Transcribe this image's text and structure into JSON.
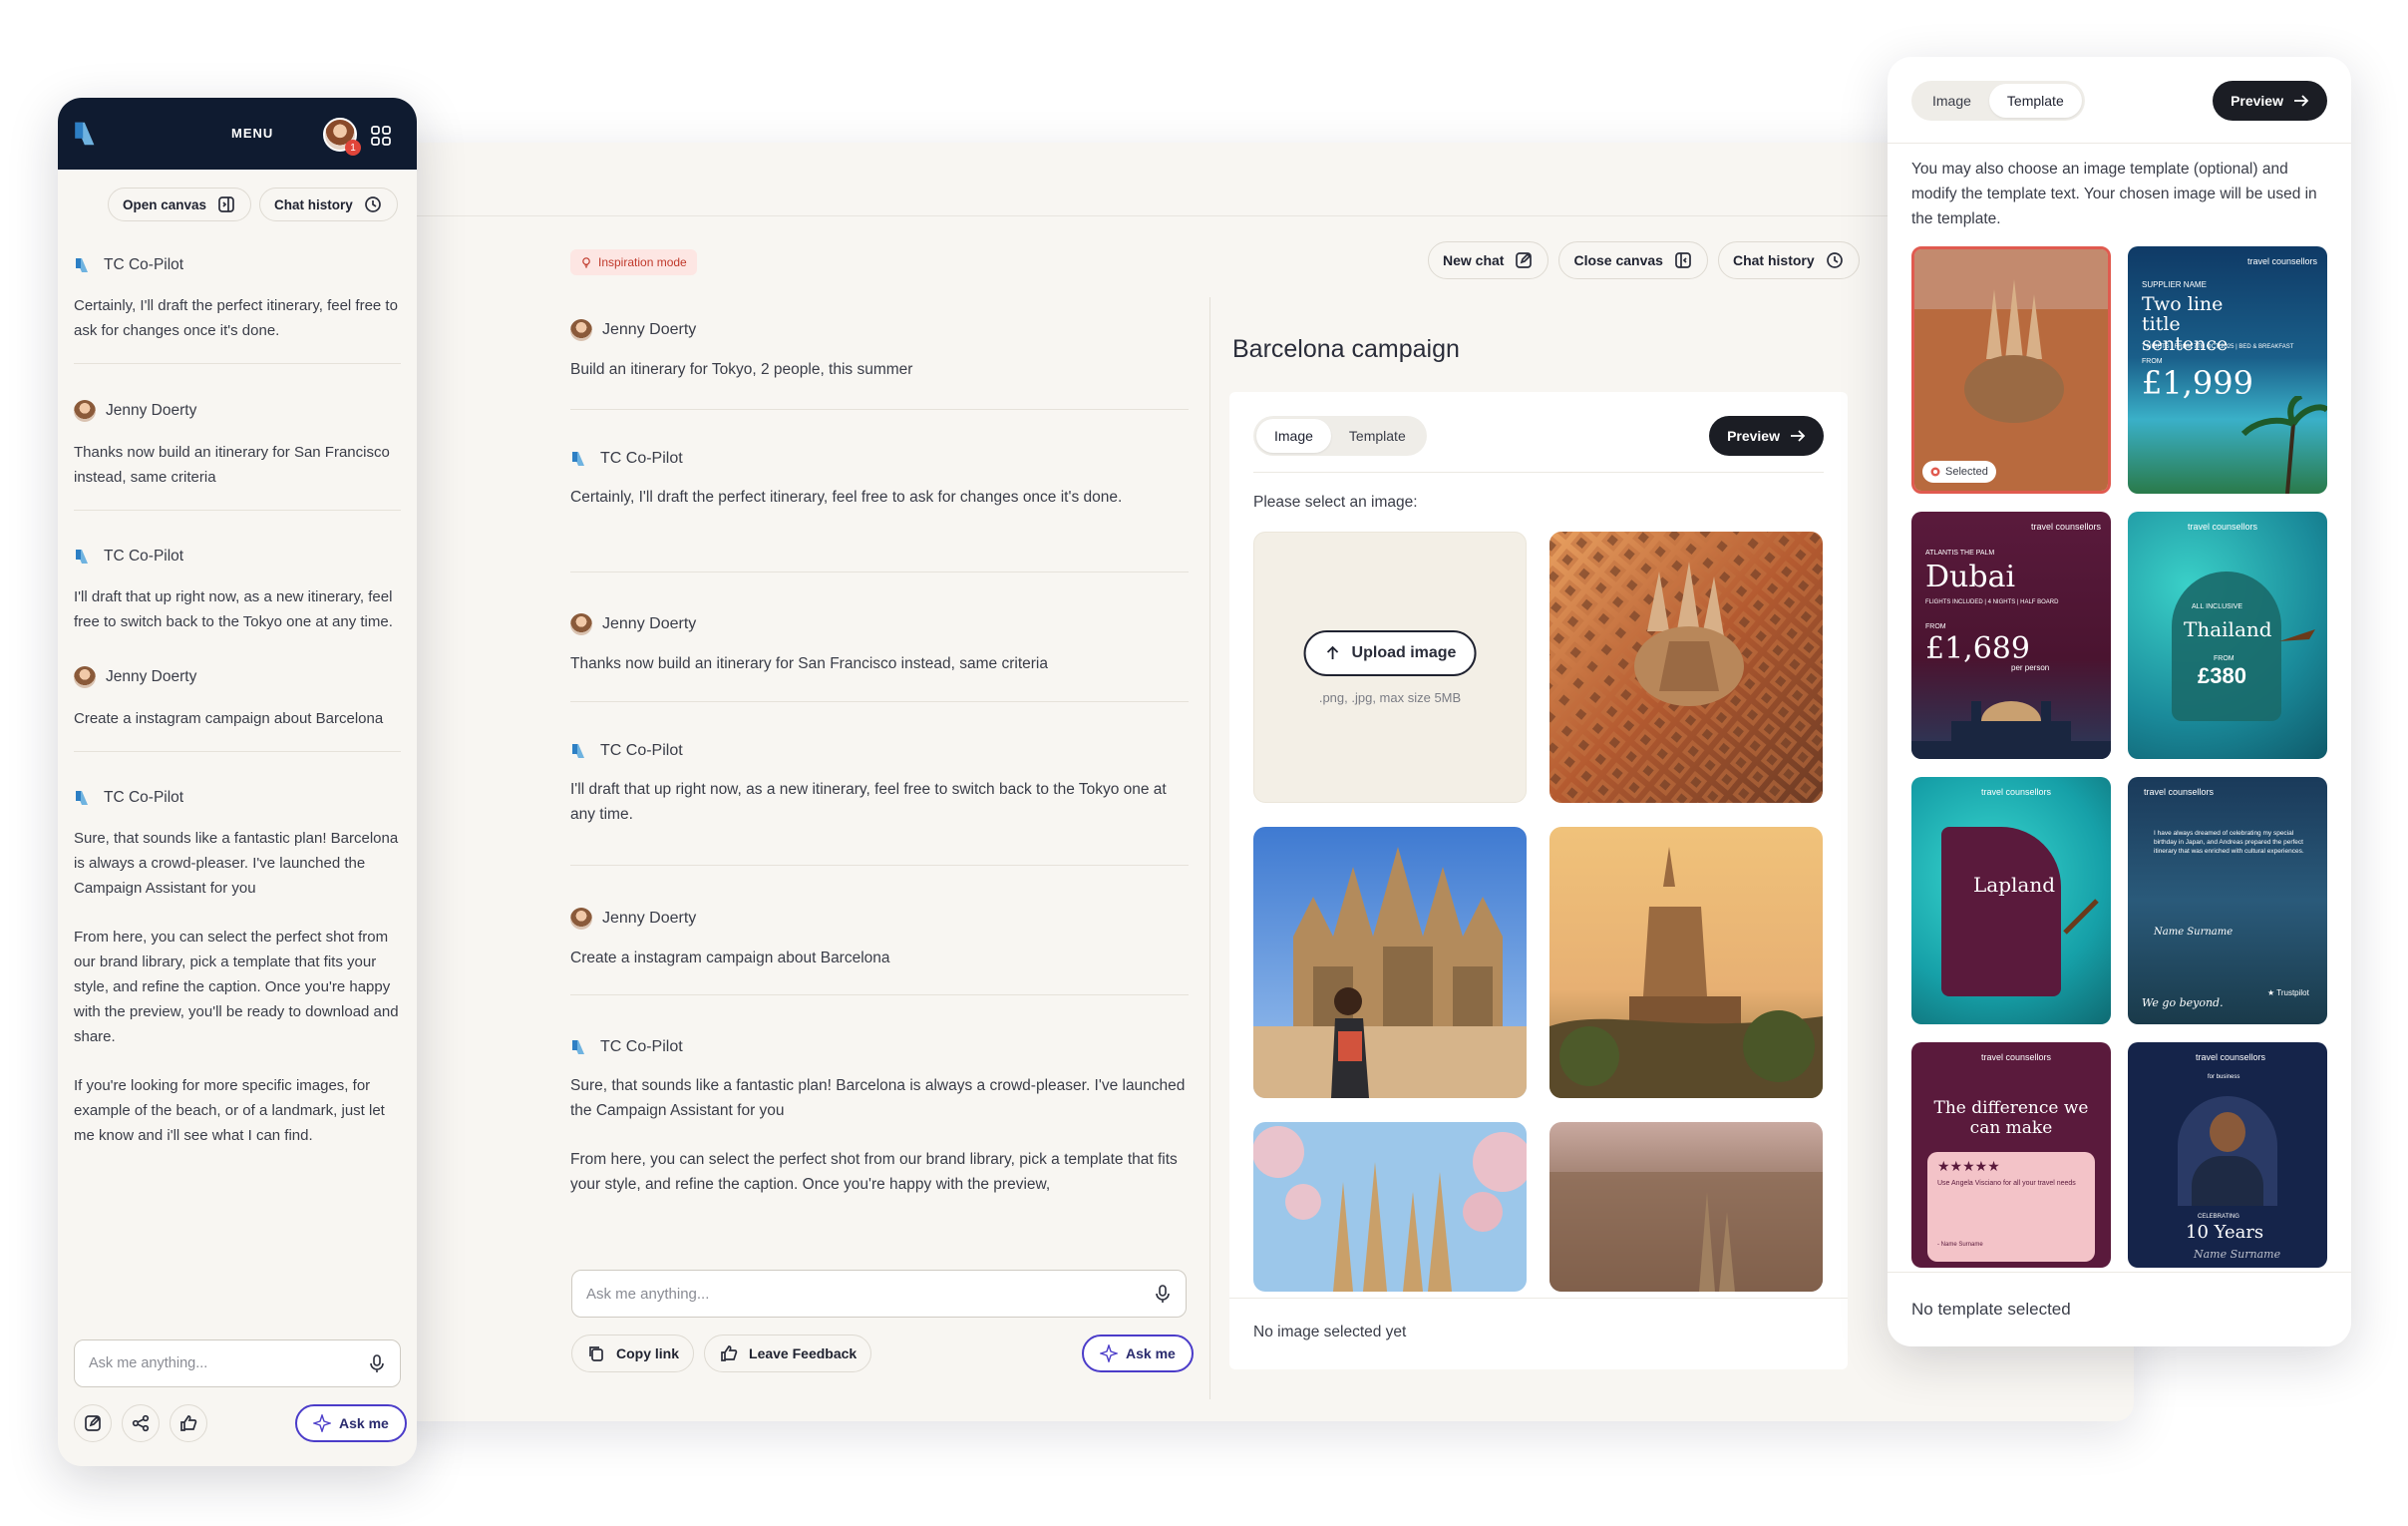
{
  "main": {
    "toolbar": {
      "new_chat": "New chat",
      "close_canvas": "Close canvas",
      "chat_history": "Chat history"
    },
    "badge": "Inspiration mode",
    "messages": [
      {
        "sender": "Jenny Doerty",
        "text": "Build an itinerary for Tokyo, 2 people, this summer"
      },
      {
        "sender": "TC Co-Pilot",
        "text": "Certainly, I'll draft the perfect itinerary, feel free to ask for changes once it's done."
      },
      {
        "sender": "Jenny Doerty",
        "text": "Thanks now build an itinerary for San Francisco instead, same criteria"
      },
      {
        "sender": "TC Co-Pilot",
        "text": "I'll draft that up right now, as a new itinerary, feel free to switch back to the Tokyo one at any time."
      },
      {
        "sender": "Jenny Doerty",
        "text": "Create a instagram campaign about Barcelona"
      },
      {
        "sender": "TC Co-Pilot",
        "text": "Sure, that sounds like a fantastic plan! Barcelona is always a crowd-pleaser. I've launched the Campaign Assistant for you",
        "text2": "From here, you can select the perfect shot from our brand library, pick a template that fits your style, and refine the caption. Once you're happy with the preview,"
      }
    ],
    "input_placeholder": "Ask me anything...",
    "copy_link": "Copy link",
    "leave_feedback": "Leave Feedback",
    "ask_me": "Ask me"
  },
  "canvas": {
    "title": "Barcelona campaign",
    "tab_image": "Image",
    "tab_template": "Template",
    "preview": "Preview",
    "prompt": "Please select an image:",
    "upload_label": "Upload image",
    "upload_hint": ".png, .jpg, max size 5MB",
    "status": "No image selected yet"
  },
  "phone": {
    "menu": "MENU",
    "notif_count": "1",
    "open_canvas": "Open canvas",
    "chat_history": "Chat history",
    "messages": [
      {
        "sender": "TC Co-Pilot",
        "text": "Certainly, I'll draft the perfect itinerary, feel free to ask for changes once it's done."
      },
      {
        "sender": "Jenny Doerty",
        "text": "Thanks now build an itinerary for San Francisco instead, same criteria"
      },
      {
        "sender": "TC Co-Pilot",
        "text": "I'll draft that up right now, as a new itinerary, feel free to switch back to the Tokyo one at any time."
      },
      {
        "sender": "Jenny Doerty",
        "text": "Create a instagram campaign about Barcelona"
      },
      {
        "sender": "TC Co-Pilot",
        "text": "Sure, that sounds like a fantastic plan! Barcelona is always a crowd-pleaser. I've launched the Campaign Assistant for you",
        "text2": "From here, you can select the perfect shot from our brand library, pick a template that fits your style, and refine the caption. Once you're happy with the preview, you'll be ready to download and share.",
        "text3": "If you're looking for more specific images, for example of the beach, or of a landmark, just let me know and i'll see what I can find."
      }
    ],
    "input_placeholder": "Ask me anything...",
    "ask_me": "Ask me"
  },
  "panel": {
    "tab_image": "Image",
    "tab_template": "Template",
    "preview": "Preview",
    "description": "You may also choose an image template (optional) and modify the template text. Your chosen image will be used in the template.",
    "selected": "Selected",
    "status": "No template selected",
    "brand": "travel counsellors",
    "templates": {
      "t2": {
        "supplier": "SUPPLIER NAME",
        "title": "Two line title sentence",
        "small": "7 NIGHTS | FROM 7TH OCT 2025 | BED & BREAKFAST",
        "from": "FROM",
        "price": "£1,999"
      },
      "t3": {
        "kicker": "ATLANTIS THE PALM",
        "title": "Dubai",
        "small": "FLIGHTS INCLUDED | 4 NIGHTS | HALF BOARD",
        "from": "FROM",
        "price": "£1,689",
        "per": "per person"
      },
      "t4": {
        "kicker": "ALL INCLUSIVE",
        "title": "Thailand",
        "from": "FROM",
        "price": "£380"
      },
      "t5": {
        "title": "Lapland"
      },
      "t6": {
        "quote": "I have always dreamed of celebrating my special birthday in Japan, and Andreas prepared the perfect itinerary that was enriched with cultural experiences.",
        "name": "Name Surname",
        "tag": "We go beyond.",
        "trust": "Trustpilot"
      },
      "t7": {
        "title": "The difference we can make",
        "stars": "★★★★★",
        "quote": "Use Angela Visciano for all your travel needs",
        "name": "- Name Surname"
      },
      "t8": {
        "sub": "for business",
        "celebrating": "CELEBRATING",
        "title": "10 Years",
        "name": "Name Surname"
      }
    }
  },
  "colors": {
    "accent": "#4b3cc9",
    "navy": "#0f1b30",
    "badge": "#c0392b",
    "selected": "#e05a4f",
    "plum": "#5a1a3c",
    "teal": "#1fa6a8"
  }
}
